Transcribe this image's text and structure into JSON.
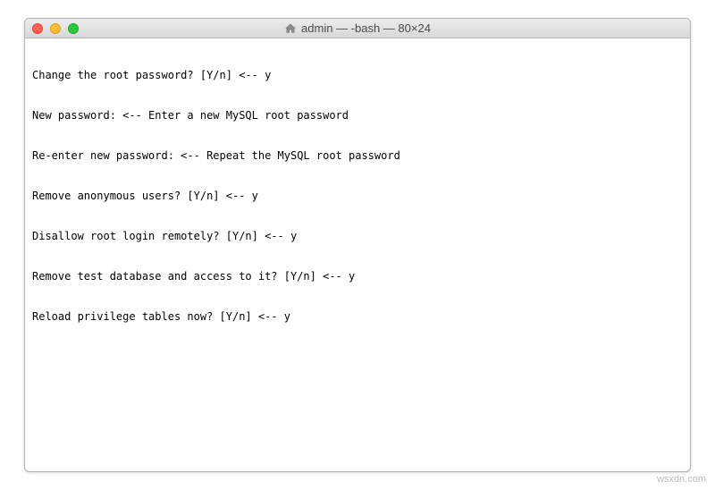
{
  "window": {
    "title": "admin — -bash — 80×24"
  },
  "terminal": {
    "lines": [
      "Change the root password? [Y/n] <-- y",
      "New password: <-- Enter a new MySQL root password",
      "Re-enter new password: <-- Repeat the MySQL root password",
      "Remove anonymous users? [Y/n] <-- y",
      "Disallow root login remotely? [Y/n] <-- y",
      "Remove test database and access to it? [Y/n] <-- y",
      "Reload privilege tables now? [Y/n] <-- y"
    ]
  },
  "watermark": "wsxdn.com"
}
